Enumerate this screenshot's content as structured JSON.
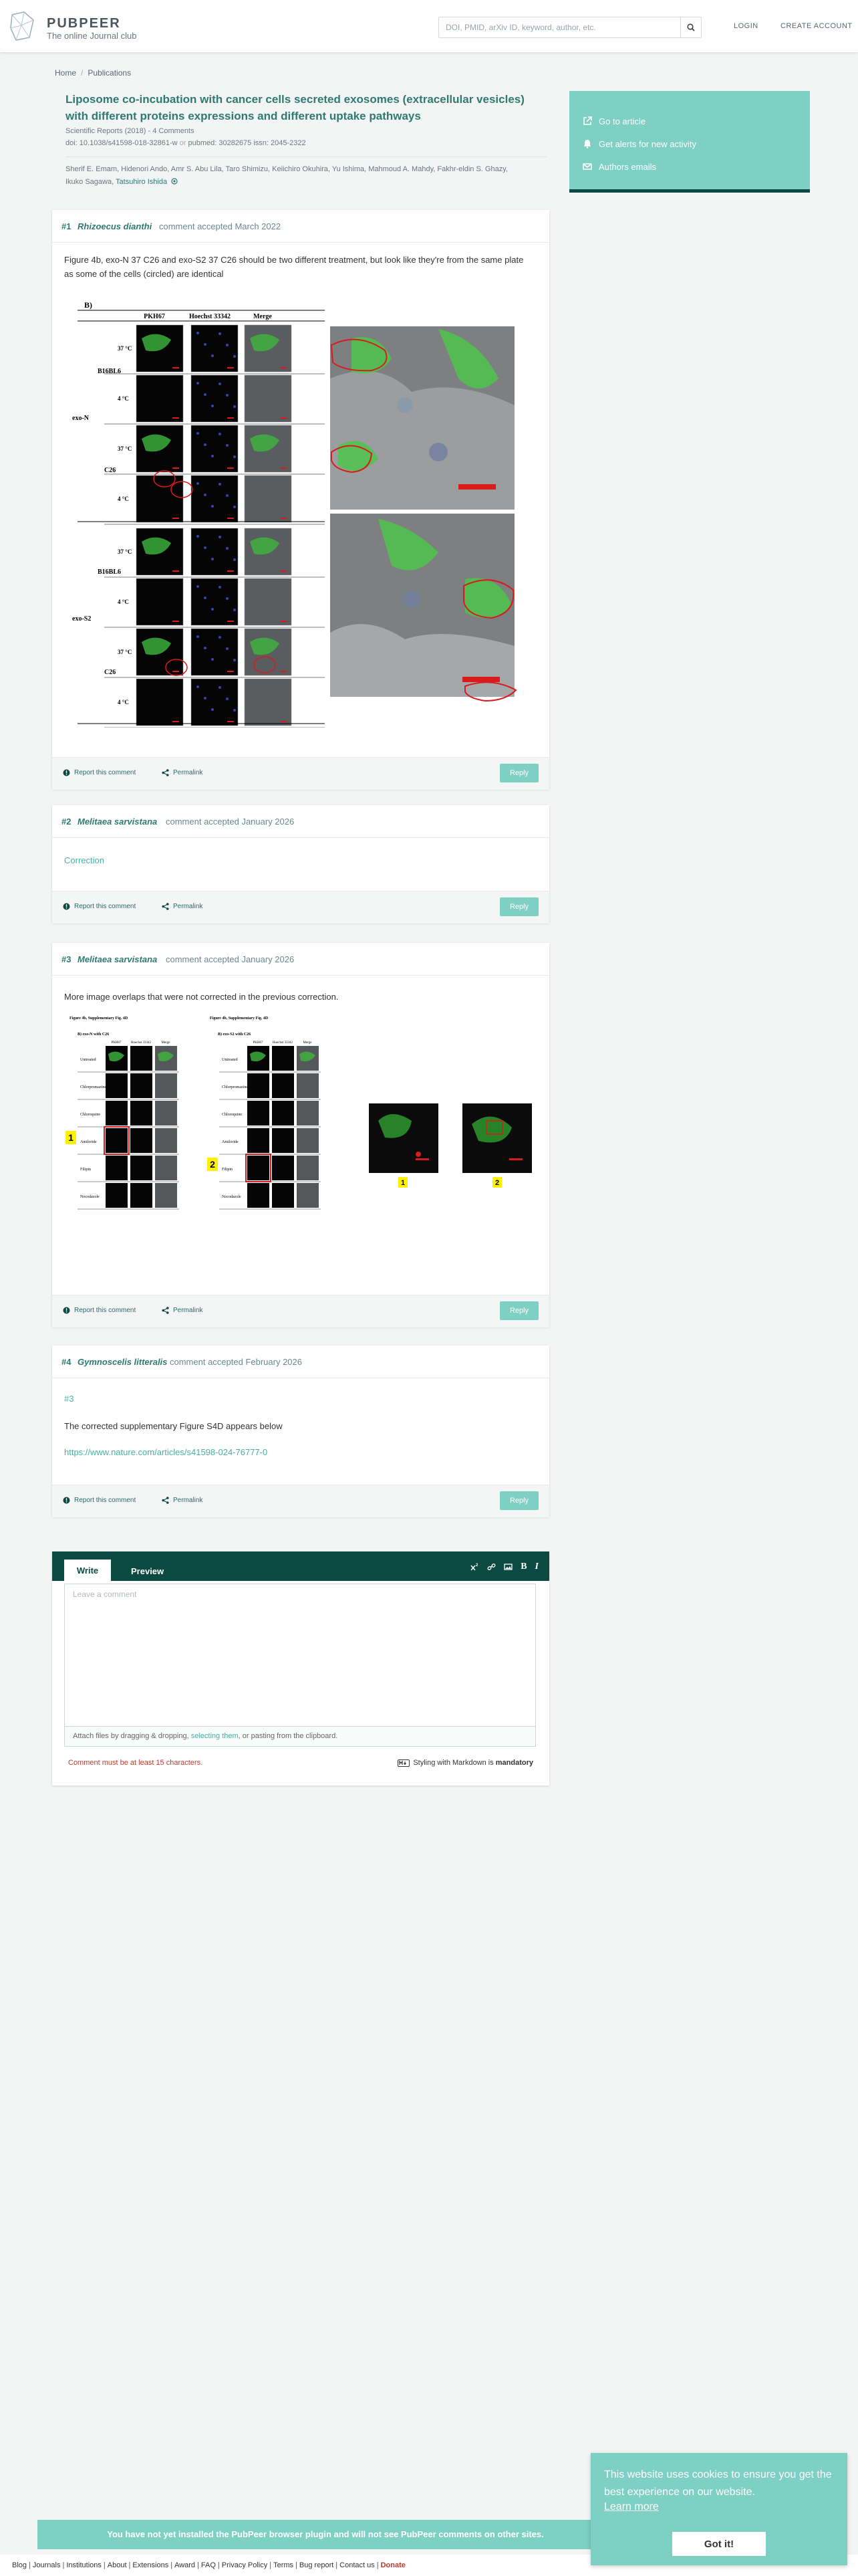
{
  "header": {
    "brand": "PUBPEER",
    "tagline": "The online Journal club",
    "search_placeholder": "DOI, PMID, arXiv ID, keyword, author, etc.",
    "login": "LOGIN",
    "create_account": "CREATE ACCOUNT"
  },
  "breadcrumb": [
    "Home",
    "Publications"
  ],
  "paper": {
    "title": "Liposome co-incubation with cancer cells secreted exosomes (extracellular vesicles) with different proteins expressions and different uptake pathways",
    "journal": "Scientific Reports (2018)",
    "comments_count": "4 Comments",
    "doi": "doi: 10.1038/s41598-018-32861-w",
    "pubmed": "pubmed: 30282675",
    "issn": "issn: 2045-2322",
    "authors_line1": "Sherif E. Emam, Hidenori Ando, Amr S. Abu Lila, Taro Shimizu, Keiichiro Okuhira, Yu Ishima, Mahmoud A. Mahdy, Fakhr-eldin S. Ghazy,",
    "authors_line2_plain": "Ikuko Sagawa, ",
    "authors_line2_link": "Tatsuhiro Ishida"
  },
  "sidebar": {
    "items": [
      {
        "label": "Go to article",
        "icon": "external-link-icon"
      },
      {
        "label": "Get alerts for new activity",
        "icon": "bell-icon"
      },
      {
        "label": "Authors emails",
        "icon": "envelope-icon"
      }
    ]
  },
  "comments": [
    {
      "number": "#1",
      "user": "Rhizoecus dianthi",
      "accepted": "comment accepted March 2022",
      "text": "Figure 4b, exo-N 37 C26 and exo-S2 37 C26 should be two different treatment, but look like they're from the same plate as some of the cells (circled) are identical",
      "figure": {
        "panel": "B)",
        "columns": [
          "PKH67",
          "Hoechst 33342",
          "Merge"
        ],
        "groups": [
          "exo-N",
          "exo-S2"
        ],
        "cells": [
          "B16BL6",
          "C26"
        ],
        "temps": [
          "37 °C",
          "4 °C"
        ]
      }
    },
    {
      "number": "#2",
      "user": "Melitaea sarvistana",
      "accepted": "comment accepted January 2026",
      "link": "Correction"
    },
    {
      "number": "#3",
      "user": "Melitaea sarvistana",
      "accepted": "comment accepted January 2026",
      "text": "More image overlaps that were not corrected in the previous correction.",
      "figure": {
        "panel_left": "Figure 4b, Supplementary Fig. 4D",
        "panel_right": "Figure 4b, Supplementary Fig. 4D",
        "group_left": "B) exo-N with C26",
        "group_right": "B) exo-S2 with C26",
        "columns": [
          "PKH67",
          "Hoechst 33342",
          "Merge"
        ],
        "rows": [
          "Untreated",
          "Chlorpromazine",
          "Chloroquine",
          "Amiloride",
          "Filipin",
          "Nocodazole"
        ],
        "markers": [
          "1",
          "2"
        ]
      }
    },
    {
      "number": "#4",
      "user": "Gymnoscelis litteralis",
      "accepted": "comment accepted February 2026",
      "ref": "#3",
      "text": "The corrected supplementary Figure S4D appears below",
      "link": "https://www.nature.com/articles/s41598-024-76777-0"
    }
  ],
  "comment_actions": {
    "report": "Report this comment",
    "permalink": "Permalink",
    "reply": "Reply"
  },
  "editor": {
    "tab_write": "Write",
    "tab_preview": "Preview",
    "placeholder": "Leave a comment",
    "attach_pre": "Attach files by dragging & dropping, ",
    "attach_link": "selecting them",
    "attach_post": ", or pasting from the clipboard.",
    "warning": "Comment must be at least 15 characters.",
    "markdown_pre": "Styling with Markdown is",
    "markdown_bold": "mandatory",
    "toolbar": {
      "bold": "B",
      "italic": "I"
    }
  },
  "plugin_banner": "You have not yet installed the PubPeer browser plugin and will not see PubPeer comments on other sites.",
  "footer": {
    "links": [
      "Blog",
      "Journals",
      "Institutions",
      "About",
      "Extensions",
      "Award",
      "FAQ",
      "Privacy Policy",
      "Terms",
      "Bug report",
      "Contact us"
    ],
    "donate": "Donate"
  },
  "cookie": {
    "message": "This website uses cookies to ensure you get the best experience on our website.",
    "learn_more": "Learn more",
    "button": "Got it!"
  },
  "colors": {
    "accent": "#2f7a73",
    "teal": "#7ecfc4",
    "dark_teal": "#0b4a40",
    "link": "#4aafa3",
    "warning": "#c0392b"
  }
}
